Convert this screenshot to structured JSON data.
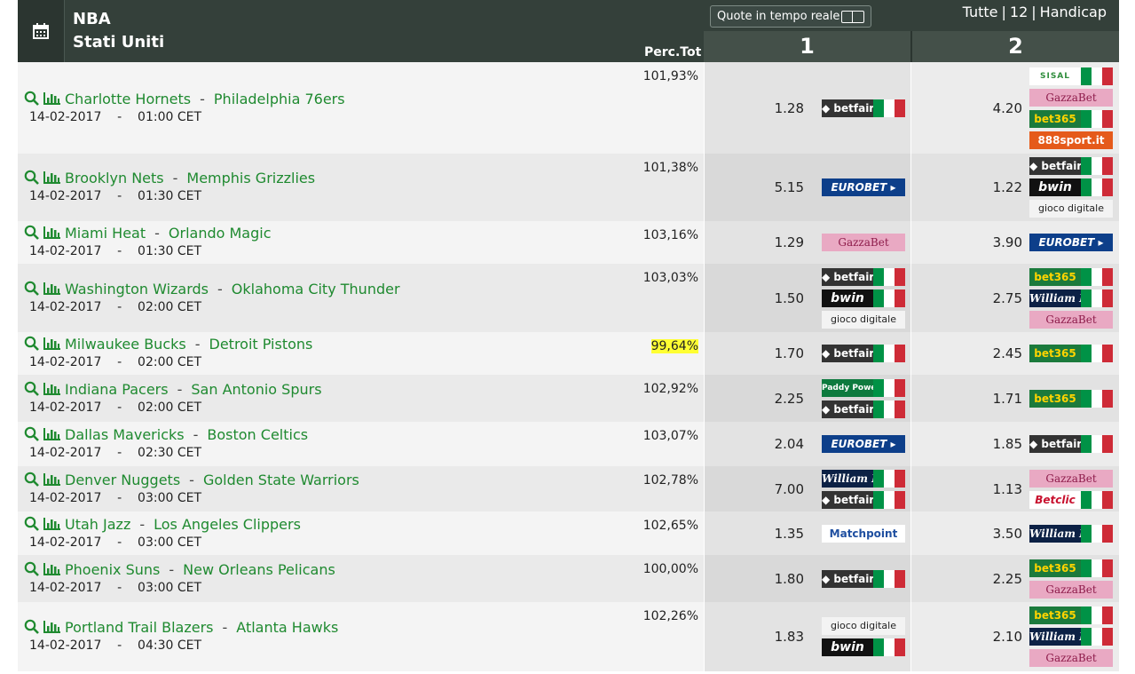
{
  "header": {
    "league": "NBA",
    "country": "Stati Uniti",
    "perc_label": "Perc.Tot",
    "live_quotes_label": "Quote in tempo reale",
    "filters": [
      "Tutte",
      "12",
      "Handicap"
    ],
    "col1": "1",
    "col2": "2"
  },
  "matches": [
    {
      "home": "Charlotte Hornets",
      "away": "Philadelphia 76ers",
      "date": "14-02-2017",
      "time": "01:00 CET",
      "perc": "101,93%",
      "odd1": "1.28",
      "odd2": "4.20",
      "books1": [
        "betfair"
      ],
      "books2": [
        "sisal",
        "gazza",
        "bet365",
        "sport888"
      ]
    },
    {
      "home": "Brooklyn Nets",
      "away": "Memphis Grizzlies",
      "date": "14-02-2017",
      "time": "01:30 CET",
      "perc": "101,38%",
      "odd1": "5.15",
      "odd2": "1.22",
      "books1": [
        "eurobet"
      ],
      "books2": [
        "betfair",
        "bwin",
        "gioco"
      ]
    },
    {
      "home": "Miami Heat",
      "away": "Orlando Magic",
      "date": "14-02-2017",
      "time": "01:30 CET",
      "perc": "103,16%",
      "odd1": "1.29",
      "odd2": "3.90",
      "books1": [
        "gazza"
      ],
      "books2": [
        "eurobet"
      ]
    },
    {
      "home": "Washington Wizards",
      "away": "Oklahoma City Thunder",
      "date": "14-02-2017",
      "time": "02:00 CET",
      "perc": "103,03%",
      "odd1": "1.50",
      "odd2": "2.75",
      "books1": [
        "betfair",
        "bwin",
        "gioco"
      ],
      "books2": [
        "bet365",
        "william",
        "gazza"
      ]
    },
    {
      "home": "Milwaukee Bucks",
      "away": "Detroit Pistons",
      "date": "14-02-2017",
      "time": "02:00 CET",
      "perc": "99,64%",
      "highlight": true,
      "odd1": "1.70",
      "odd2": "2.45",
      "books1": [
        "betfair"
      ],
      "books2": [
        "bet365"
      ]
    },
    {
      "home": "Indiana Pacers",
      "away": "San Antonio Spurs",
      "date": "14-02-2017",
      "time": "02:00 CET",
      "perc": "102,92%",
      "odd1": "2.25",
      "odd2": "1.71",
      "books1": [
        "paddy",
        "betfair"
      ],
      "books2": [
        "bet365"
      ]
    },
    {
      "home": "Dallas Mavericks",
      "away": "Boston Celtics",
      "date": "14-02-2017",
      "time": "02:30 CET",
      "perc": "103,07%",
      "odd1": "2.04",
      "odd2": "1.85",
      "books1": [
        "eurobet"
      ],
      "books2": [
        "betfair"
      ]
    },
    {
      "home": "Denver Nuggets",
      "away": "Golden State Warriors",
      "date": "14-02-2017",
      "time": "03:00 CET",
      "perc": "102,78%",
      "odd1": "7.00",
      "odd2": "1.13",
      "books1": [
        "william",
        "betfair"
      ],
      "books2": [
        "gazza",
        "betclic"
      ]
    },
    {
      "home": "Utah Jazz",
      "away": "Los Angeles Clippers",
      "date": "14-02-2017",
      "time": "03:00 CET",
      "perc": "102,65%",
      "odd1": "1.35",
      "odd2": "3.50",
      "books1": [
        "matchpoint"
      ],
      "books2": [
        "william"
      ]
    },
    {
      "home": "Phoenix Suns",
      "away": "New Orleans Pelicans",
      "date": "14-02-2017",
      "time": "03:00 CET",
      "perc": "100,00%",
      "odd1": "1.80",
      "odd2": "2.25",
      "books1": [
        "betfair"
      ],
      "books2": [
        "bet365",
        "gazza"
      ]
    },
    {
      "home": "Portland Trail Blazers",
      "away": "Atlanta Hawks",
      "date": "14-02-2017",
      "time": "04:30 CET",
      "perc": "102,26%",
      "odd1": "1.83",
      "odd2": "2.10",
      "books1": [
        "gioco",
        "bwin"
      ],
      "books2": [
        "bet365",
        "william",
        "gazza"
      ]
    }
  ],
  "bookmakers": {
    "betfair": {
      "label": "◆ betfair",
      "flag": true
    },
    "bwin": {
      "label": "bwin",
      "flag": true
    },
    "bet365": {
      "label": "bet365",
      "flag": true
    },
    "gazza": {
      "label": "GazzaBet",
      "flag": false
    },
    "eurobet": {
      "label": "EUROBET ▸",
      "flag": false
    },
    "gioco": {
      "label": "gioco digitale",
      "flag": false
    },
    "william": {
      "label": "William HILL",
      "flag": true
    },
    "paddy": {
      "label": "Paddy Power",
      "flag": true
    },
    "betclic": {
      "label": "Betclic",
      "flag": true
    },
    "sisal": {
      "label": "SISAL",
      "flag": true
    },
    "sport888": {
      "label": "888sport.it",
      "flag": false
    },
    "matchpoint": {
      "label": "Matchpoint",
      "flag": false
    }
  },
  "colors": {
    "header_bg": "#34403a",
    "link": "#1f8a30",
    "highlight": "#ffff33"
  }
}
